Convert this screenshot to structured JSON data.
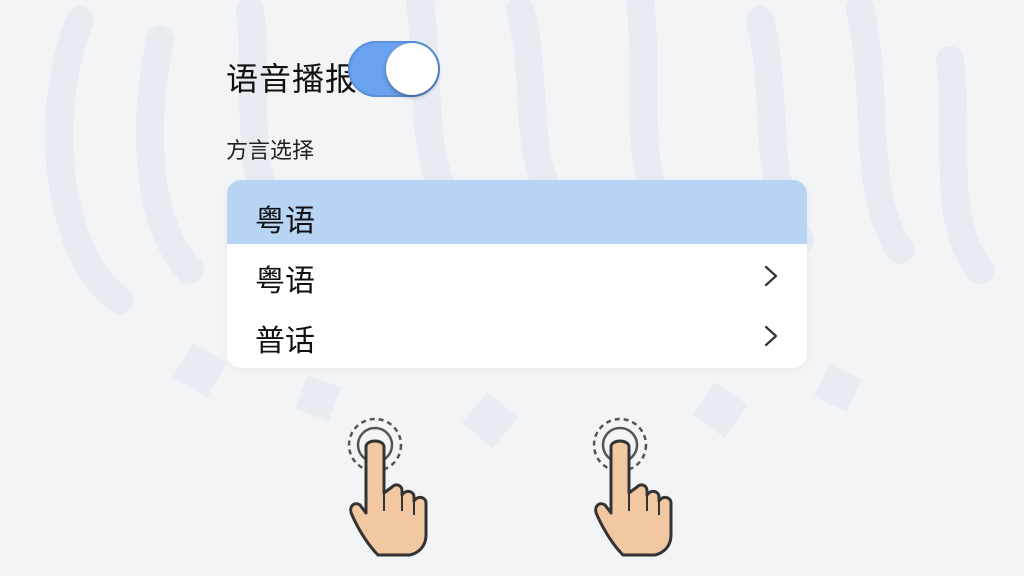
{
  "voice_broadcast": {
    "label": "语音播报",
    "enabled": true
  },
  "dialect_section": {
    "label": "方言选择",
    "selected": "粤语",
    "options": [
      {
        "label": "粤语",
        "icon": "chevron-right-icon"
      },
      {
        "label": "普话",
        "icon": "chevron-right-icon"
      }
    ]
  },
  "decorations": {
    "hands": [
      "tap-hand-icon",
      "tap-hand-icon"
    ]
  },
  "colors": {
    "toggle_on": "#6aa2ef",
    "selected_header": "#b8d4f5",
    "background": "#f3f4f6"
  }
}
